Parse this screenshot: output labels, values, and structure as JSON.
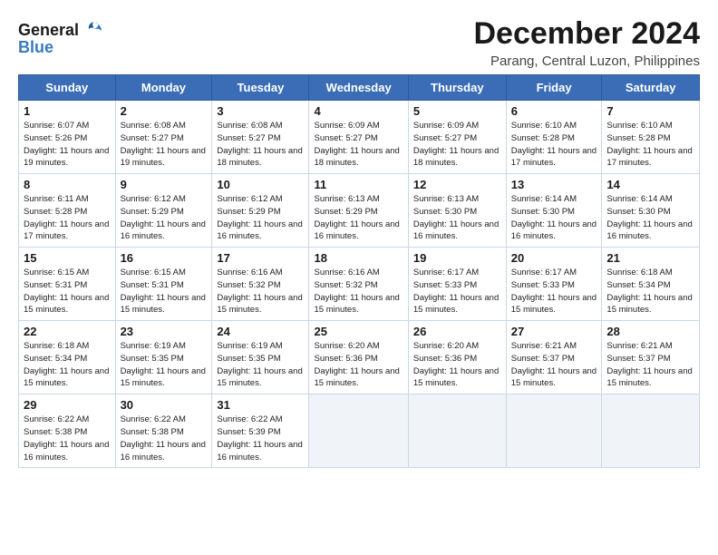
{
  "logo": {
    "line1": "General",
    "line2": "Blue"
  },
  "title": "December 2024",
  "subtitle": "Parang, Central Luzon, Philippines",
  "weekdays": [
    "Sunday",
    "Monday",
    "Tuesday",
    "Wednesday",
    "Thursday",
    "Friday",
    "Saturday"
  ],
  "weeks": [
    [
      {
        "day": "1",
        "sunrise": "6:07 AM",
        "sunset": "5:26 PM",
        "daylight": "11 hours and 19 minutes."
      },
      {
        "day": "2",
        "sunrise": "6:08 AM",
        "sunset": "5:27 PM",
        "daylight": "11 hours and 19 minutes."
      },
      {
        "day": "3",
        "sunrise": "6:08 AM",
        "sunset": "5:27 PM",
        "daylight": "11 hours and 18 minutes."
      },
      {
        "day": "4",
        "sunrise": "6:09 AM",
        "sunset": "5:27 PM",
        "daylight": "11 hours and 18 minutes."
      },
      {
        "day": "5",
        "sunrise": "6:09 AM",
        "sunset": "5:27 PM",
        "daylight": "11 hours and 18 minutes."
      },
      {
        "day": "6",
        "sunrise": "6:10 AM",
        "sunset": "5:28 PM",
        "daylight": "11 hours and 17 minutes."
      },
      {
        "day": "7",
        "sunrise": "6:10 AM",
        "sunset": "5:28 PM",
        "daylight": "11 hours and 17 minutes."
      }
    ],
    [
      {
        "day": "8",
        "sunrise": "6:11 AM",
        "sunset": "5:28 PM",
        "daylight": "11 hours and 17 minutes."
      },
      {
        "day": "9",
        "sunrise": "6:12 AM",
        "sunset": "5:29 PM",
        "daylight": "11 hours and 16 minutes."
      },
      {
        "day": "10",
        "sunrise": "6:12 AM",
        "sunset": "5:29 PM",
        "daylight": "11 hours and 16 minutes."
      },
      {
        "day": "11",
        "sunrise": "6:13 AM",
        "sunset": "5:29 PM",
        "daylight": "11 hours and 16 minutes."
      },
      {
        "day": "12",
        "sunrise": "6:13 AM",
        "sunset": "5:30 PM",
        "daylight": "11 hours and 16 minutes."
      },
      {
        "day": "13",
        "sunrise": "6:14 AM",
        "sunset": "5:30 PM",
        "daylight": "11 hours and 16 minutes."
      },
      {
        "day": "14",
        "sunrise": "6:14 AM",
        "sunset": "5:30 PM",
        "daylight": "11 hours and 16 minutes."
      }
    ],
    [
      {
        "day": "15",
        "sunrise": "6:15 AM",
        "sunset": "5:31 PM",
        "daylight": "11 hours and 15 minutes."
      },
      {
        "day": "16",
        "sunrise": "6:15 AM",
        "sunset": "5:31 PM",
        "daylight": "11 hours and 15 minutes."
      },
      {
        "day": "17",
        "sunrise": "6:16 AM",
        "sunset": "5:32 PM",
        "daylight": "11 hours and 15 minutes."
      },
      {
        "day": "18",
        "sunrise": "6:16 AM",
        "sunset": "5:32 PM",
        "daylight": "11 hours and 15 minutes."
      },
      {
        "day": "19",
        "sunrise": "6:17 AM",
        "sunset": "5:33 PM",
        "daylight": "11 hours and 15 minutes."
      },
      {
        "day": "20",
        "sunrise": "6:17 AM",
        "sunset": "5:33 PM",
        "daylight": "11 hours and 15 minutes."
      },
      {
        "day": "21",
        "sunrise": "6:18 AM",
        "sunset": "5:34 PM",
        "daylight": "11 hours and 15 minutes."
      }
    ],
    [
      {
        "day": "22",
        "sunrise": "6:18 AM",
        "sunset": "5:34 PM",
        "daylight": "11 hours and 15 minutes."
      },
      {
        "day": "23",
        "sunrise": "6:19 AM",
        "sunset": "5:35 PM",
        "daylight": "11 hours and 15 minutes."
      },
      {
        "day": "24",
        "sunrise": "6:19 AM",
        "sunset": "5:35 PM",
        "daylight": "11 hours and 15 minutes."
      },
      {
        "day": "25",
        "sunrise": "6:20 AM",
        "sunset": "5:36 PM",
        "daylight": "11 hours and 15 minutes."
      },
      {
        "day": "26",
        "sunrise": "6:20 AM",
        "sunset": "5:36 PM",
        "daylight": "11 hours and 15 minutes."
      },
      {
        "day": "27",
        "sunrise": "6:21 AM",
        "sunset": "5:37 PM",
        "daylight": "11 hours and 15 minutes."
      },
      {
        "day": "28",
        "sunrise": "6:21 AM",
        "sunset": "5:37 PM",
        "daylight": "11 hours and 15 minutes."
      }
    ],
    [
      {
        "day": "29",
        "sunrise": "6:22 AM",
        "sunset": "5:38 PM",
        "daylight": "11 hours and 16 minutes."
      },
      {
        "day": "30",
        "sunrise": "6:22 AM",
        "sunset": "5:38 PM",
        "daylight": "11 hours and 16 minutes."
      },
      {
        "day": "31",
        "sunrise": "6:22 AM",
        "sunset": "5:39 PM",
        "daylight": "11 hours and 16 minutes."
      },
      null,
      null,
      null,
      null
    ]
  ]
}
